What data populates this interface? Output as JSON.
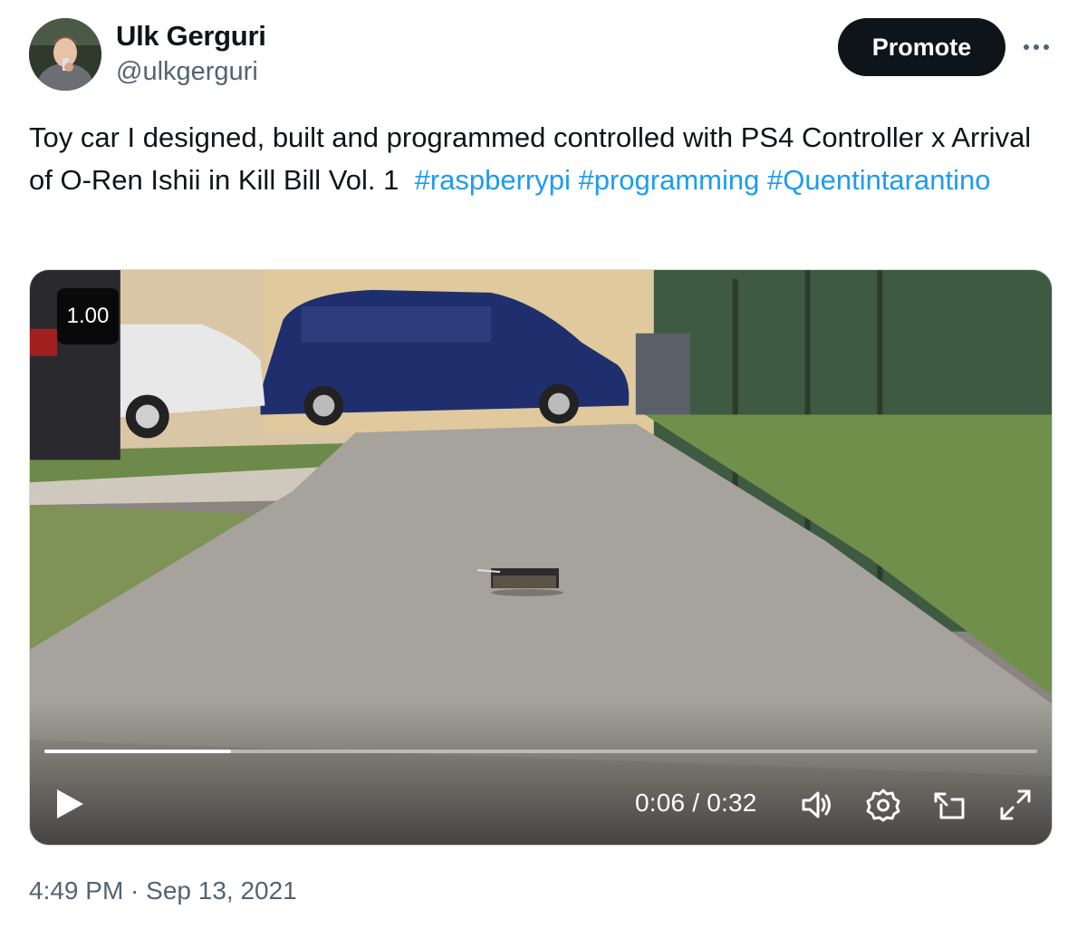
{
  "author": {
    "name": "Ulk Gerguri",
    "handle": "@ulkgerguri"
  },
  "actions": {
    "promote_label": "Promote",
    "more_icon": "more-horizontal-icon"
  },
  "tweet": {
    "text": "Toy car I designed, built and programmed controlled with PS4 Controller x Arrival of O-Ren Ishii in Kill Bill Vol. 1",
    "hashtags": [
      "#raspberrypi",
      "#programming",
      "#Quentintarantino"
    ],
    "timestamp": "4:49 PM · Sep 13, 2021"
  },
  "video": {
    "speed": "1.00",
    "current_time": "0:06",
    "duration": "0:32",
    "time_display": "0:06 / 0:32",
    "progress": 0.1875,
    "icons": [
      "play-icon",
      "volume-icon",
      "settings-icon",
      "picture-in-picture-icon",
      "fullscreen-icon"
    ]
  },
  "colors": {
    "text": "#0f1419",
    "secondary": "#536471",
    "link": "#1d9bf0",
    "button_bg": "#0f1419"
  }
}
